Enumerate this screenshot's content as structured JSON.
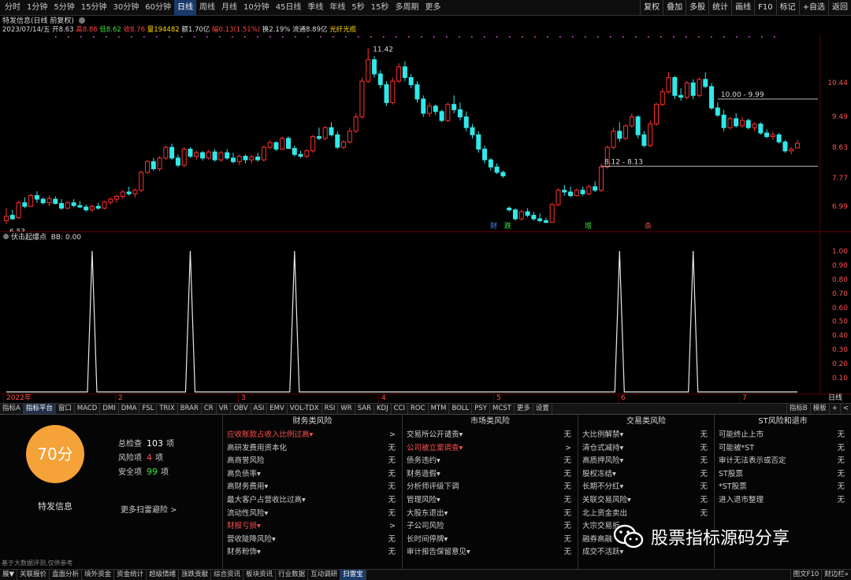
{
  "toolbar": {
    "periods": [
      "分时",
      "1分钟",
      "5分钟",
      "15分钟",
      "30分钟",
      "60分钟",
      "日线",
      "周线",
      "月线",
      "10分钟",
      "45日线",
      "季线",
      "年线",
      "5秒",
      "15秒",
      "多周期",
      "更多"
    ],
    "active_period": "日线",
    "right_buttons": [
      "复权",
      "叠加",
      "多股",
      "统计",
      "画线",
      "F10",
      "标记",
      "+自选",
      "返回"
    ]
  },
  "stock_header": {
    "title": "特发信息(日线 前复权)",
    "date": "2023/07/14/五",
    "open_label": "开",
    "open": "8.63",
    "high_label": "高",
    "high": "8.86",
    "low_label": "低",
    "low": "8.62",
    "close_label": "收",
    "close": "8.76",
    "volume_label": "量",
    "volume": "194482",
    "amount_label": "额",
    "amount": "1.70亿",
    "change_label": "幅",
    "change": "0.13(1.51%)",
    "turnover_label": "换",
    "turnover": "2.19%",
    "float_label": "流通",
    "float": "8.89亿",
    "concept": "光纤光缆"
  },
  "price_axis": {
    "ticks": [
      "10.44",
      "9.49",
      "8.63",
      "7.77",
      "6.99"
    ],
    "values": [
      10.44,
      9.49,
      8.63,
      7.77,
      6.99
    ]
  },
  "annotations": {
    "high_label": "11.42",
    "low_label": "6.53",
    "resistance_label": "10.00 - 9.99",
    "support_label": "8.12 - 8.13",
    "signal_marks": [
      "财",
      "跌",
      "增",
      "杀"
    ]
  },
  "sub_indicator": {
    "name": "伏击起爆点",
    "value_label": "BB: 0.00",
    "axis_ticks": [
      "1.00",
      "0.90",
      "0.80",
      "0.70",
      "0.60",
      "0.50",
      "0.40",
      "0.30",
      "0.20",
      "0.10"
    ]
  },
  "date_axis": {
    "labels": [
      "2022年",
      "2",
      "3",
      "4",
      "5",
      "6",
      "7"
    ],
    "unit": "日线"
  },
  "indicator_tabs": [
    "指标A",
    "指标平台",
    "窗口",
    "MACD",
    "DMI",
    "DMA",
    "FSL",
    "TRIX",
    "BRAR",
    "CR",
    "VR",
    "OBV",
    "ASI",
    "EMV",
    "VOL-TDX",
    "RSI",
    "WR",
    "SAR",
    "KDJ",
    "CCI",
    "ROC",
    "MTM",
    "BOLL",
    "PSY",
    "MCST",
    "更多",
    "设置"
  ],
  "indicator_right": [
    "指标B",
    "模板",
    "+",
    "<"
  ],
  "risk_panel": {
    "score": "70分",
    "stock_name": "特发信息",
    "stats": [
      {
        "label": "总检查",
        "value": "103",
        "unit": "项",
        "color": "#ffffff"
      },
      {
        "label": "风险项",
        "value": "4",
        "unit": "项",
        "color": "#ff5050"
      },
      {
        "label": "安全项",
        "value": "99",
        "unit": "项",
        "color": "#40e040"
      }
    ],
    "more": "更多扫雷避险 >",
    "disclaimer": "基于大数据评测,仅供参考",
    "columns": [
      {
        "title": "财务类风险",
        "rows": [
          {
            "label": "应收账款占收入比例过高▾",
            "status": ">",
            "hi": true
          },
          {
            "label": "高研发费用资本化",
            "status": "无",
            "hi": false
          },
          {
            "label": "高商誉风险",
            "status": "无",
            "hi": false
          },
          {
            "label": "高负债率▾",
            "status": "无",
            "hi": false
          },
          {
            "label": "高财务费用▾",
            "status": "无",
            "hi": false
          },
          {
            "label": "最大客户占营收比过高▾",
            "status": "无",
            "hi": false
          },
          {
            "label": "流动性风险▾",
            "status": "无",
            "hi": false
          },
          {
            "label": "财报亏损▾",
            "status": ">",
            "hi": true
          },
          {
            "label": "营收陡降风险▾",
            "status": "无",
            "hi": false
          },
          {
            "label": "财务粉饰▾",
            "status": "无",
            "hi": false
          }
        ]
      },
      {
        "title": "市场类风险",
        "rows": [
          {
            "label": "交易所公开谴责▾",
            "status": "无",
            "hi": false
          },
          {
            "label": "公司被立案调查▾",
            "status": ">",
            "hi": true
          },
          {
            "label": "债务违约▾",
            "status": "无",
            "hi": false
          },
          {
            "label": "财务造假▾",
            "status": "无",
            "hi": false
          },
          {
            "label": "分析师评级下调",
            "status": "无",
            "hi": false
          },
          {
            "label": "管理风险▾",
            "status": "无",
            "hi": false
          },
          {
            "label": "大股东退出▾",
            "status": "无",
            "hi": false
          },
          {
            "label": "子公司风险",
            "status": "无",
            "hi": false
          },
          {
            "label": "长时间停牌▾",
            "status": "无",
            "hi": false
          },
          {
            "label": "审计报告保留意见▾",
            "status": "无",
            "hi": false
          }
        ]
      },
      {
        "title": "交易类风险",
        "rows": [
          {
            "label": "大比例解禁▾",
            "status": "无",
            "hi": false
          },
          {
            "label": "清仓式减持▾",
            "status": "无",
            "hi": false
          },
          {
            "label": "高质押风险▾",
            "status": "无",
            "hi": false
          },
          {
            "label": "股权冻结▾",
            "status": "无",
            "hi": false
          },
          {
            "label": "长期不分红▾",
            "status": "无",
            "hi": false
          },
          {
            "label": "关联交易风险▾",
            "status": "无",
            "hi": false
          },
          {
            "label": "北上资金卖出",
            "status": "无",
            "hi": false
          },
          {
            "label": "大宗交易折",
            "status": "",
            "hi": false
          },
          {
            "label": "融券高融",
            "status": "",
            "hi": false
          },
          {
            "label": "成交不活跃▾",
            "status": "",
            "hi": false
          }
        ]
      },
      {
        "title": "ST风险和退市",
        "rows": [
          {
            "label": "可能终止上市",
            "status": "无",
            "hi": false
          },
          {
            "label": "可能被*ST",
            "status": "无",
            "hi": false
          },
          {
            "label": "审计无法表示或否定",
            "status": "无",
            "hi": false
          },
          {
            "label": "ST股票",
            "status": "无",
            "hi": false
          },
          {
            "label": "*ST股票",
            "status": "无",
            "hi": false
          },
          {
            "label": "进入退市整理",
            "status": "无",
            "hi": false
          }
        ]
      }
    ]
  },
  "bottom_tabs": [
    "展▼",
    "关联报价",
    "盘面分析",
    "境外资金",
    "资金统计",
    "超级情绪",
    "涨跌贡献",
    "综合资讯",
    "板块资讯",
    "行业数据",
    "互动调研",
    "扫雷宝"
  ],
  "bottom_active": "扫雷宝",
  "bottom_right": [
    "图文F10",
    "财边栏»"
  ],
  "watermark": "股票指标源码分享",
  "colors": {
    "up": "#ff3030",
    "down": "#30e8e8",
    "accent": "#f5a238",
    "axis": "#5a0000",
    "signal": "#e050e0"
  },
  "chart_data": [
    {
      "type": "candlestick",
      "name": "特发信息",
      "ylim": [
        6.3,
        11.8
      ],
      "x_labels": [
        "2022年",
        "2",
        "3",
        "4",
        "5",
        "6",
        "7"
      ],
      "candles": [
        [
          6.6,
          6.95,
          6.5,
          6.72
        ],
        [
          6.75,
          6.9,
          6.62,
          6.65
        ],
        [
          6.68,
          7.15,
          6.65,
          7.1
        ],
        [
          7.1,
          7.25,
          6.95,
          7.0
        ],
        [
          7.0,
          7.35,
          6.98,
          7.3
        ],
        [
          7.3,
          7.42,
          7.1,
          7.2
        ],
        [
          7.2,
          7.25,
          7.05,
          7.1
        ],
        [
          7.1,
          7.3,
          7.0,
          7.22
        ],
        [
          7.2,
          7.28,
          7.05,
          7.08
        ],
        [
          7.08,
          7.2,
          6.9,
          6.95
        ],
        [
          6.95,
          7.15,
          6.92,
          7.1
        ],
        [
          7.1,
          7.2,
          6.98,
          7.02
        ],
        [
          7.02,
          7.15,
          6.95,
          6.98
        ],
        [
          6.98,
          7.05,
          6.85,
          6.9
        ],
        [
          6.9,
          7.05,
          6.85,
          7.0
        ],
        [
          7.0,
          7.1,
          6.9,
          6.95
        ],
        [
          6.95,
          7.15,
          6.92,
          7.12
        ],
        [
          7.12,
          7.25,
          7.05,
          7.2
        ],
        [
          7.2,
          7.32,
          7.1,
          7.28
        ],
        [
          7.28,
          7.45,
          7.2,
          7.4
        ],
        [
          7.4,
          7.55,
          7.3,
          7.35
        ],
        [
          7.35,
          7.5,
          7.25,
          7.45
        ],
        [
          7.45,
          8.0,
          7.4,
          7.95
        ],
        [
          7.95,
          8.3,
          7.9,
          8.25
        ],
        [
          8.25,
          8.35,
          8.0,
          8.05
        ],
        [
          8.05,
          8.4,
          7.98,
          8.35
        ],
        [
          8.35,
          8.7,
          8.3,
          8.65
        ],
        [
          8.65,
          8.75,
          8.3,
          8.35
        ],
        [
          8.35,
          8.45,
          8.1,
          8.15
        ],
        [
          8.15,
          8.65,
          8.1,
          8.6
        ],
        [
          8.6,
          8.65,
          8.35,
          8.4
        ],
        [
          8.4,
          8.55,
          8.3,
          8.5
        ],
        [
          8.5,
          8.55,
          8.28,
          8.35
        ],
        [
          8.35,
          8.58,
          8.3,
          8.52
        ],
        [
          8.52,
          8.6,
          8.25,
          8.3
        ],
        [
          8.3,
          8.55,
          8.25,
          8.5
        ],
        [
          8.5,
          8.6,
          8.3,
          8.35
        ],
        [
          8.35,
          8.5,
          8.2,
          8.25
        ],
        [
          8.25,
          8.45,
          8.15,
          8.4
        ],
        [
          8.4,
          8.45,
          8.2,
          8.3
        ],
        [
          8.3,
          8.45,
          8.2,
          8.38
        ],
        [
          8.38,
          8.5,
          8.25,
          8.3
        ],
        [
          8.3,
          8.7,
          8.25,
          8.65
        ],
        [
          8.65,
          8.85,
          8.6,
          8.78
        ],
        [
          8.78,
          8.82,
          8.55,
          8.6
        ],
        [
          8.6,
          8.95,
          8.58,
          8.9
        ],
        [
          8.9,
          8.95,
          8.6,
          8.62
        ],
        [
          8.62,
          8.7,
          8.4,
          8.45
        ],
        [
          8.45,
          8.55,
          8.35,
          8.4
        ],
        [
          8.4,
          8.6,
          8.35,
          8.55
        ],
        [
          8.55,
          9.0,
          8.5,
          8.95
        ],
        [
          8.95,
          9.2,
          8.85,
          8.9
        ],
        [
          8.9,
          9.25,
          8.85,
          9.2
        ],
        [
          9.2,
          9.35,
          8.95,
          9.0
        ],
        [
          9.0,
          9.1,
          8.6,
          8.65
        ],
        [
          8.65,
          8.85,
          8.6,
          8.8
        ],
        [
          8.8,
          9.2,
          8.75,
          9.1
        ],
        [
          9.1,
          9.6,
          9.05,
          9.5
        ],
        [
          9.5,
          10.6,
          9.45,
          10.5
        ],
        [
          10.5,
          11.42,
          10.45,
          11.1
        ],
        [
          11.1,
          11.2,
          10.6,
          10.7
        ],
        [
          10.7,
          10.8,
          10.3,
          10.4
        ],
        [
          10.4,
          10.5,
          9.8,
          9.9
        ],
        [
          9.9,
          10.6,
          9.85,
          10.5
        ],
        [
          10.5,
          11.0,
          10.45,
          10.9
        ],
        [
          10.9,
          11.05,
          10.5,
          10.6
        ],
        [
          10.6,
          10.7,
          10.3,
          10.4
        ],
        [
          10.4,
          10.5,
          9.9,
          10.0
        ],
        [
          10.0,
          10.1,
          9.5,
          9.6
        ],
        [
          9.6,
          9.9,
          9.5,
          9.8
        ],
        [
          9.8,
          9.85,
          9.55,
          9.65
        ],
        [
          9.65,
          9.7,
          9.35,
          9.4
        ],
        [
          9.4,
          9.9,
          9.35,
          9.85
        ],
        [
          9.85,
          10.1,
          9.6,
          9.7
        ],
        [
          9.7,
          9.9,
          9.4,
          9.5
        ],
        [
          9.5,
          9.65,
          9.1,
          9.2
        ],
        [
          9.2,
          9.3,
          8.9,
          9.0
        ],
        [
          9.0,
          9.1,
          8.5,
          8.6
        ],
        [
          8.6,
          8.7,
          8.2,
          8.3
        ],
        [
          8.3,
          8.35,
          8.0,
          8.1
        ],
        [
          8.1,
          8.2,
          7.9,
          7.95
        ],
        [
          7.95,
          8.0,
          7.8,
          7.85
        ],
        [
          6.95,
          7.0,
          6.85,
          6.9
        ],
        [
          6.9,
          6.95,
          6.6,
          6.65
        ],
        [
          6.65,
          6.9,
          6.6,
          6.85
        ],
        [
          6.85,
          6.95,
          6.7,
          6.75
        ],
        [
          6.75,
          6.85,
          6.6,
          6.65
        ],
        [
          6.65,
          6.8,
          6.55,
          6.6
        ],
        [
          6.6,
          6.68,
          6.53,
          6.55
        ],
        [
          6.55,
          7.1,
          6.55,
          7.05
        ],
        [
          7.05,
          7.5,
          7.0,
          7.45
        ],
        [
          7.45,
          7.6,
          7.3,
          7.4
        ],
        [
          7.4,
          7.55,
          7.25,
          7.3
        ],
        [
          7.3,
          7.5,
          7.28,
          7.45
        ],
        [
          7.45,
          7.55,
          7.3,
          7.35
        ],
        [
          7.35,
          7.6,
          7.3,
          7.55
        ],
        [
          7.55,
          7.7,
          7.4,
          7.45
        ],
        [
          7.45,
          8.2,
          7.4,
          8.1
        ],
        [
          8.1,
          8.7,
          8.05,
          8.65
        ],
        [
          8.65,
          9.2,
          8.6,
          9.1
        ],
        [
          9.1,
          9.35,
          8.8,
          8.9
        ],
        [
          8.9,
          9.3,
          8.85,
          9.25
        ],
        [
          9.25,
          9.6,
          9.2,
          9.5
        ],
        [
          9.5,
          9.55,
          8.9,
          9.0
        ],
        [
          9.0,
          9.1,
          8.65,
          8.7
        ],
        [
          8.7,
          9.4,
          8.65,
          9.3
        ],
        [
          9.3,
          9.9,
          9.25,
          9.85
        ],
        [
          9.85,
          10.3,
          9.8,
          10.2
        ],
        [
          10.2,
          10.75,
          10.15,
          10.6
        ],
        [
          10.6,
          10.65,
          10.0,
          10.1
        ],
        [
          10.1,
          10.3,
          9.95,
          10.05
        ],
        [
          10.05,
          10.5,
          10.0,
          10.45
        ],
        [
          10.45,
          10.55,
          10.0,
          10.1
        ],
        [
          10.1,
          10.6,
          10.05,
          10.55
        ],
        [
          10.55,
          10.75,
          10.3,
          10.35
        ],
        [
          10.35,
          10.45,
          9.7,
          9.75
        ],
        [
          9.75,
          9.9,
          9.5,
          9.55
        ],
        [
          9.55,
          9.7,
          9.1,
          9.2
        ],
        [
          9.2,
          9.5,
          9.15,
          9.45
        ],
        [
          9.45,
          9.6,
          9.2,
          9.25
        ],
        [
          9.25,
          9.5,
          9.2,
          9.4
        ],
        [
          9.4,
          9.45,
          9.15,
          9.2
        ],
        [
          9.2,
          9.35,
          9.1,
          9.3
        ],
        [
          9.3,
          9.35,
          9.0,
          9.05
        ],
        [
          9.05,
          9.15,
          8.9,
          8.95
        ],
        [
          8.95,
          9.1,
          8.85,
          9.0
        ],
        [
          9.0,
          9.05,
          8.75,
          8.8
        ],
        [
          8.8,
          8.85,
          8.5,
          8.55
        ],
        [
          8.55,
          8.65,
          8.45,
          8.6
        ],
        [
          8.63,
          8.86,
          8.62,
          8.76
        ]
      ]
    },
    {
      "type": "line",
      "name": "BB",
      "ylim": [
        0,
        1.05
      ],
      "spike_candle_index": [
        14,
        30,
        47,
        100,
        112
      ],
      "spike_value": 1.0
    }
  ]
}
